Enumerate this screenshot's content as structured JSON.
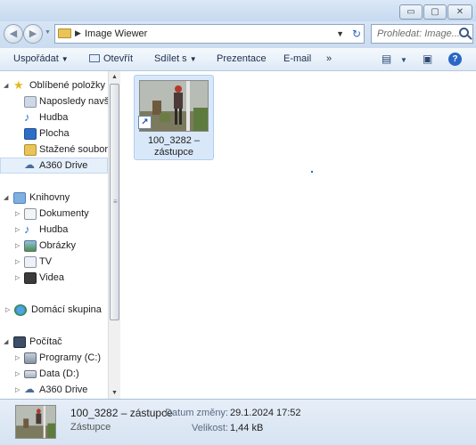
{
  "window": {
    "min_glyph": "▭",
    "max_glyph": "▢",
    "close_glyph": "✕"
  },
  "address": {
    "path": "Image Wiewer",
    "search_placeholder": "Prohledat: Image..."
  },
  "toolbar": {
    "organize": "Uspořádat",
    "open": "Otevřít",
    "share": "Sdílet s",
    "present": "Prezentace",
    "email": "E-mail",
    "more": "»",
    "help": "?"
  },
  "nav": {
    "favorites": "Oblíbené položky",
    "recent": "Naposledy navští",
    "music_fav": "Hudba",
    "desktop": "Plocha",
    "downloads": "Stažené soubory",
    "a360_fav": "A360 Drive",
    "libraries": "Knihovny",
    "documents": "Dokumenty",
    "music": "Hudba",
    "pictures": "Obrázky",
    "tv": "TV",
    "videos": "Videa",
    "homegroup": "Domácí skupina",
    "computer": "Počítač",
    "programs": "Programy (C:)",
    "data": "Data (D:)",
    "a360": "A360 Drive"
  },
  "file": {
    "name_line1": "100_3282 –",
    "name_line2": "zástupce"
  },
  "details": {
    "name": "100_3282 – zástupce",
    "type": "Zástupce",
    "modified_label": "Datum změny:",
    "modified_value": "29.1.2024 17:52",
    "size_label": "Velikost:",
    "size_value": "1,44 kB"
  },
  "colors": {
    "accent": "#2a67c5",
    "selection": "#d9e8f9",
    "chrome": "#c9dcf1"
  }
}
